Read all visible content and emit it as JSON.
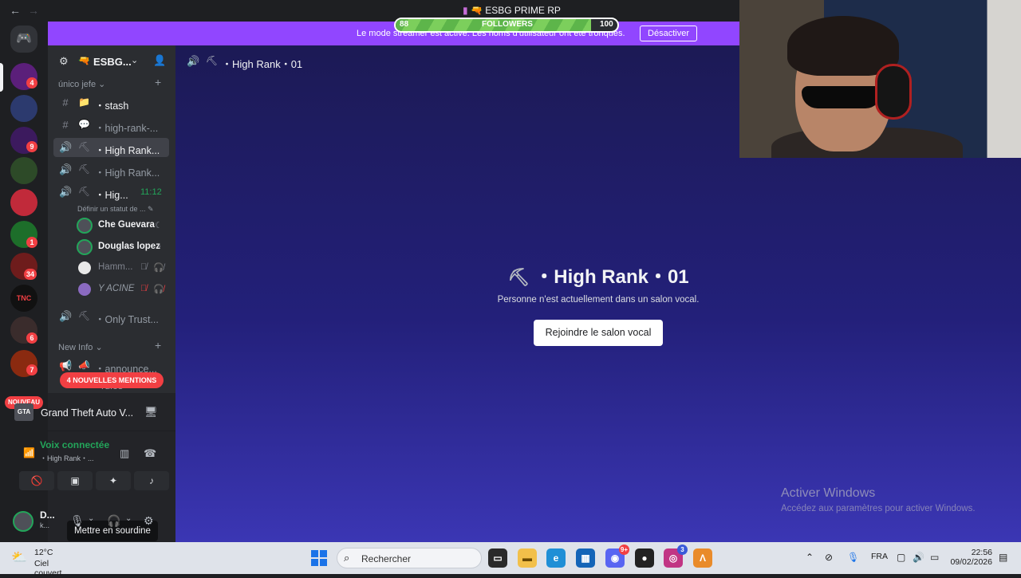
{
  "window": {
    "back": "←",
    "forward": "→",
    "title": "ESBG PRIME RP"
  },
  "streamer_banner": {
    "message": "Le mode streamer est activé. Les noms d'utilisateur ont été tronqués.",
    "button": "Désactiver"
  },
  "followers_widget": {
    "label": "FOLLOWERS",
    "current": "88",
    "goal": "100",
    "progress": 0.88
  },
  "servers": {
    "badges": [
      "4",
      "9",
      "1",
      "34",
      "6",
      "7"
    ],
    "new_label": "NOUVEAU",
    "tnc_label": "TNC Roleplay"
  },
  "guild": {
    "name": "ESBG...",
    "category1": "único jefe",
    "category2": "New Info",
    "channels": [
      {
        "label": "・stash",
        "icon": "#"
      },
      {
        "label": "・high-rank-...",
        "icon": "#"
      },
      {
        "label": "・High Rank...",
        "icon": "🔊"
      },
      {
        "label": "・High Rank...",
        "icon": "🔊"
      },
      {
        "label": "・Hig...",
        "icon": "🔊",
        "time": "11:12"
      }
    ],
    "status_hint": "Définir un statut de ...",
    "voice_users": [
      {
        "name": "Che Guevara"
      },
      {
        "name": "Douglas lopez"
      },
      {
        "name": "Hamm..."
      },
      {
        "name": "Y ACINE"
      }
    ],
    "only_trust": "・Only Trust...",
    "announce": "・announce...",
    "rules": "rules",
    "mentions": "4 NOUVELLES MENTIONS"
  },
  "activity": {
    "game": "Grand Theft Auto V...",
    "logo": "GTA"
  },
  "voice": {
    "status": "Voix connectée",
    "channel": "・High Rank・..."
  },
  "tooltip": "Mettre en sourdine",
  "user": {
    "name": "D...",
    "tag": "k..."
  },
  "main": {
    "header": "・High Rank・01",
    "heading": "・High Rank・01",
    "empty_text": "Personne n'est actuellement dans un salon vocal.",
    "join_button": "Rejoindre le salon vocal"
  },
  "watermark": {
    "title": "Activer Windows",
    "subtitle": "Accédez aux paramètres pour activer Windows."
  },
  "taskbar": {
    "temp": "12°C",
    "weather": "Ciel couvert",
    "search": "Rechercher",
    "discord_badge": "9+",
    "instagram_badge": "3",
    "lang": "FRA",
    "time": "22:56",
    "date": "09/02/2026"
  },
  "colors": {
    "accent": "#5865f2",
    "streamer_banner": "#9146ff",
    "connected": "#23a55a",
    "badge": "#f23f43"
  }
}
